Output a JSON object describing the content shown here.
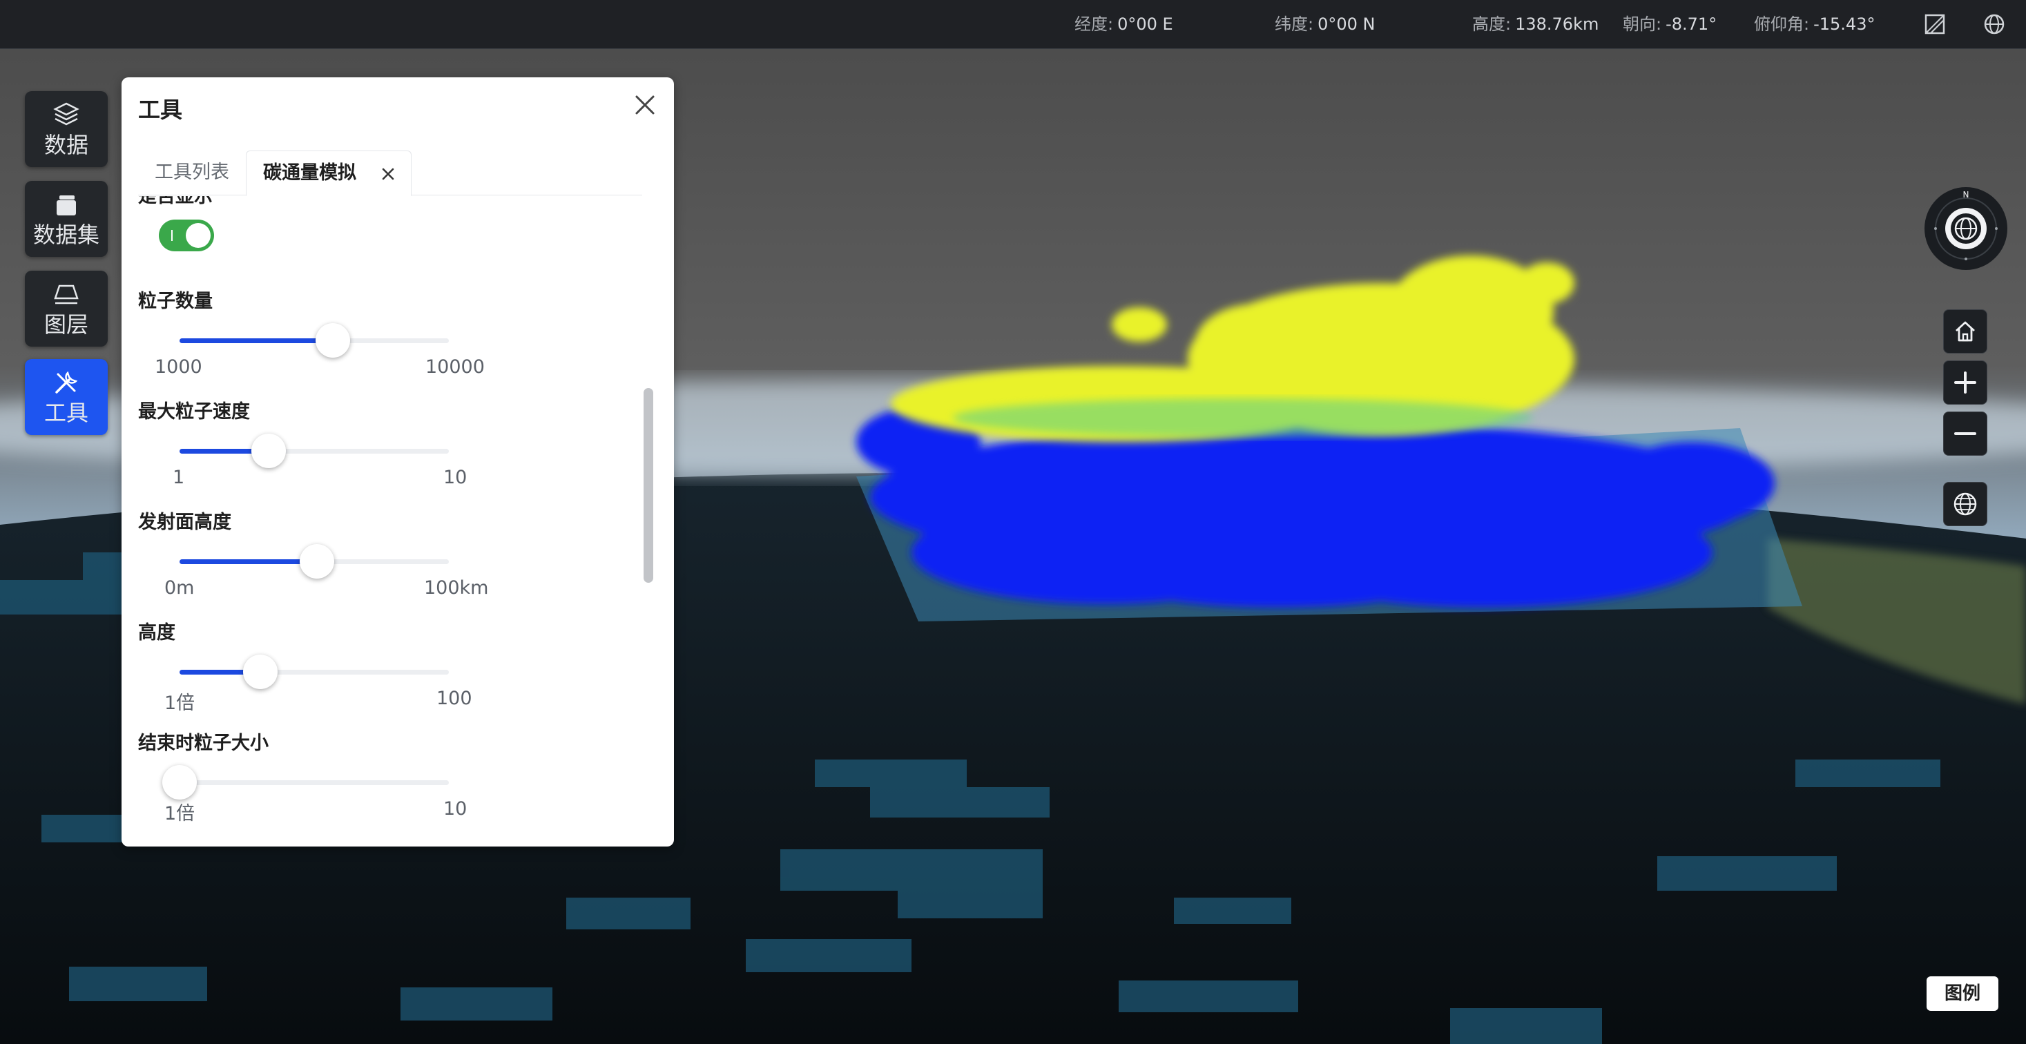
{
  "statusbar": {
    "longitude_label": "经度:",
    "longitude_value": "0°00 E",
    "latitude_label": "纬度:",
    "latitude_value": "0°00 N",
    "altitude_label": "高度:",
    "altitude_value": "138.76km",
    "heading_label": "朝向:",
    "heading_value": "-8.71°",
    "pitch_label": "俯仰角:",
    "pitch_value": "-15.43°",
    "icons": [
      "map-mode-icon",
      "globe-icon"
    ]
  },
  "sidebar": {
    "items": [
      {
        "label": "数据",
        "icon": "layers-icon",
        "active": false
      },
      {
        "label": "数据集",
        "icon": "dataset-icon",
        "active": false
      },
      {
        "label": "图层",
        "icon": "layer-plane-icon",
        "active": false
      },
      {
        "label": "工具",
        "icon": "tools-icon",
        "active": true
      }
    ]
  },
  "panel": {
    "title": "工具",
    "tabs": [
      {
        "label": "工具列表",
        "active": false
      },
      {
        "label": "碳通量模拟",
        "active": true,
        "closable": true
      }
    ],
    "show_toggle": {
      "label": "是否显示",
      "on": true
    },
    "sliders": [
      {
        "label": "粒子数量",
        "min_label": "1000",
        "max_label": "10000",
        "fraction": 0.57
      },
      {
        "label": "最大粒子速度",
        "min_label": "1",
        "max_label": "10",
        "fraction": 0.33
      },
      {
        "label": "发射面高度",
        "min_label": "0m",
        "max_label": "100km",
        "fraction": 0.51
      },
      {
        "label": "高度",
        "min_label": "1倍",
        "max_label": "100",
        "fraction": 0.3
      },
      {
        "label": "结束时粒子大小",
        "min_label": "1倍",
        "max_label": "10",
        "fraction": 0.0
      }
    ],
    "accent": "#1c49e0",
    "toggle_color": "#3aa84a"
  },
  "right_controls": {
    "compass_label": "N",
    "buttons": [
      "home-icon",
      "zoom-in-icon",
      "zoom-out-icon",
      "globe-view-icon"
    ]
  },
  "legend_button": "图例"
}
